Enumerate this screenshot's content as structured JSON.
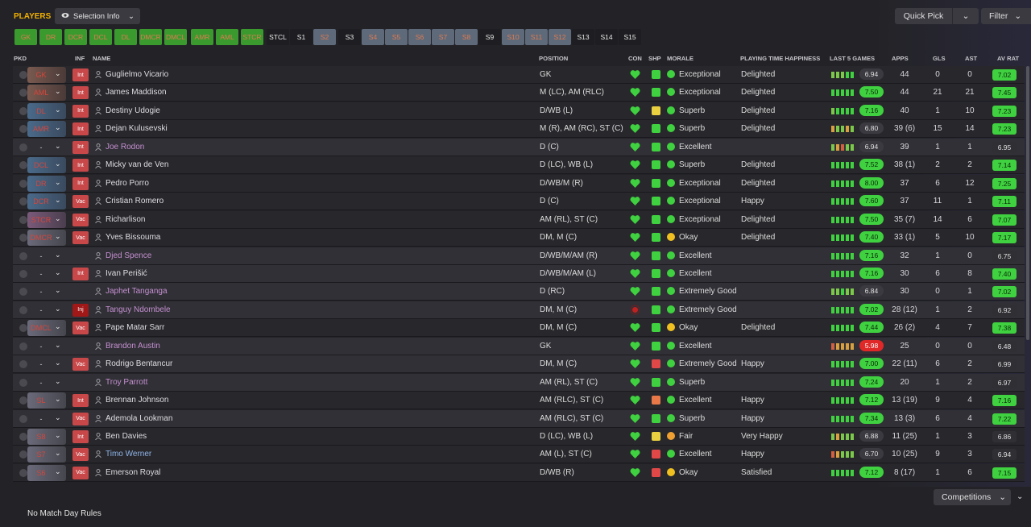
{
  "header": {
    "title": "PLAYERS",
    "selection_info": "Selection Info",
    "quick_pick": "Quick Pick",
    "filter": "Filter"
  },
  "chips": [
    {
      "label": "GK",
      "style": "g"
    },
    {
      "label": "DR",
      "style": "g"
    },
    {
      "label": "DCR",
      "style": "g"
    },
    {
      "label": "DCL",
      "style": "g"
    },
    {
      "label": "DL",
      "style": "g"
    },
    {
      "label": "DMCR",
      "style": "g"
    },
    {
      "label": "DMCL",
      "style": "g"
    },
    {
      "label": "AMR",
      "style": "g"
    },
    {
      "label": "AML",
      "style": "g"
    },
    {
      "label": "STCR",
      "style": "g"
    },
    {
      "label": "STCL",
      "style": "k"
    },
    {
      "label": "S1",
      "style": "k"
    },
    {
      "label": "S2",
      "style": "b"
    },
    {
      "label": "S3",
      "style": "k"
    },
    {
      "label": "S4",
      "style": "b"
    },
    {
      "label": "S5",
      "style": "b"
    },
    {
      "label": "S6",
      "style": "b"
    },
    {
      "label": "S7",
      "style": "b"
    },
    {
      "label": "S8",
      "style": "b"
    },
    {
      "label": "S9",
      "style": "k"
    },
    {
      "label": "S10",
      "style": "b"
    },
    {
      "label": "S11",
      "style": "b"
    },
    {
      "label": "S12",
      "style": "b"
    },
    {
      "label": "S13",
      "style": "k"
    },
    {
      "label": "S14",
      "style": "k"
    },
    {
      "label": "S15",
      "style": "k"
    }
  ],
  "columns": {
    "pkd": "PKD",
    "inf": "INF",
    "name": "NAME",
    "position": "POSITION",
    "con": "CON",
    "shp": "SHP",
    "morale": "MORALE",
    "pth": "PLAYING TIME HAPPINESS",
    "last5": "LAST 5 GAMES",
    "apps": "APPS",
    "gls": "GLS",
    "ast": "AST",
    "avr": "AV RAT"
  },
  "colors": {
    "accent": "#f0b000",
    "good": "#3fd13f",
    "green_chip": "#3a9a2e",
    "inf_red": "#c8484a"
  },
  "rows": [
    {
      "sel": "GK",
      "selStyle": "p",
      "inf": "Int",
      "name": "Guglielmo Vicario",
      "nameStyle": "",
      "pos": "GK",
      "shp": "g",
      "mor": "g",
      "morale": "Exceptional",
      "pth": "Delighted",
      "bars": [
        "#7cc84a",
        "#7cc84a",
        "#7cc84a",
        "#3fd13f",
        "#3fd13f"
      ],
      "l5": "6.94",
      "l5s": "n",
      "apps": "44",
      "gls": "0",
      "ast": "0",
      "avr": "7.02",
      "avrs": "g"
    },
    {
      "sel": "AML",
      "selStyle": "p",
      "inf": "Int",
      "name": "James Maddison",
      "nameStyle": "",
      "pos": "M (LC), AM (RLC)",
      "shp": "g",
      "mor": "g",
      "morale": "Exceptional",
      "pth": "Delighted",
      "bars": [
        "#3fd13f",
        "#3fd13f",
        "#3fd13f",
        "#3fd13f",
        "#3fd13f"
      ],
      "l5": "7.50",
      "l5s": "g",
      "apps": "44",
      "gls": "21",
      "ast": "21",
      "avr": "7.45",
      "avrs": "g"
    },
    {
      "sel": "DL",
      "selStyle": "bl",
      "inf": "Int",
      "name": "Destiny Udogie",
      "nameStyle": "",
      "pos": "D/WB (L)",
      "shp": "y",
      "mor": "g",
      "morale": "Superb",
      "pth": "Delighted",
      "bars": [
        "#7cc84a",
        "#3fd13f",
        "#3fd13f",
        "#3fd13f",
        "#3fd13f"
      ],
      "l5": "7.16",
      "l5s": "g",
      "apps": "40",
      "gls": "1",
      "ast": "10",
      "avr": "7.23",
      "avrs": "g"
    },
    {
      "sel": "AMR",
      "selStyle": "bl",
      "inf": "Int",
      "name": "Dejan Kulusevski",
      "nameStyle": "",
      "pos": "M (R), AM (RC), ST (C)",
      "shp": "g",
      "mor": "g",
      "morale": "Superb",
      "pth": "Delighted",
      "bars": [
        "#d8a040",
        "#7cc84a",
        "#7cc84a",
        "#d8a040",
        "#7cc84a"
      ],
      "l5": "6.80",
      "l5s": "n",
      "apps": "39 (6)",
      "gls": "15",
      "ast": "14",
      "avr": "7.23",
      "avrs": "g"
    },
    {
      "sel": "-",
      "selStyle": "none",
      "inf": "Int",
      "name": "Joe Rodon",
      "nameStyle": "loan",
      "pos": "D (C)",
      "shp": "g",
      "mor": "g",
      "morale": "Excellent",
      "pth": "",
      "bars": [
        "#7cc84a",
        "#d8a040",
        "#d06040",
        "#7cc84a",
        "#7cc84a"
      ],
      "l5": "6.94",
      "l5s": "n",
      "apps": "39",
      "gls": "1",
      "ast": "1",
      "avr": "6.95",
      "avrs": "n"
    },
    {
      "sel": "DCL",
      "selStyle": "bl",
      "inf": "Int",
      "name": "Micky van de Ven",
      "nameStyle": "",
      "pos": "D (LC), WB (L)",
      "shp": "g",
      "mor": "g",
      "morale": "Superb",
      "pth": "Delighted",
      "bars": [
        "#3fd13f",
        "#3fd13f",
        "#3fd13f",
        "#3fd13f",
        "#3fd13f"
      ],
      "l5": "7.52",
      "l5s": "g",
      "apps": "38 (1)",
      "gls": "2",
      "ast": "2",
      "avr": "7.14",
      "avrs": "g"
    },
    {
      "sel": "DR",
      "selStyle": "bl",
      "inf": "Int",
      "name": "Pedro Porro",
      "nameStyle": "",
      "pos": "D/WB/M (R)",
      "shp": "g",
      "mor": "g",
      "morale": "Exceptional",
      "pth": "Delighted",
      "bars": [
        "#3fd13f",
        "#3fd13f",
        "#3fd13f",
        "#3fd13f",
        "#3fd13f"
      ],
      "l5": "8.00",
      "l5s": "g",
      "apps": "37",
      "gls": "6",
      "ast": "12",
      "avr": "7.25",
      "avrs": "g"
    },
    {
      "sel": "DCR",
      "selStyle": "bl",
      "inf": "Vac",
      "name": "Cristian Romero",
      "nameStyle": "",
      "pos": "D (C)",
      "shp": "g",
      "mor": "g",
      "morale": "Exceptional",
      "pth": "Happy",
      "bars": [
        "#3fd13f",
        "#3fd13f",
        "#3fd13f",
        "#3fd13f",
        "#3fd13f"
      ],
      "l5": "7.60",
      "l5s": "g",
      "apps": "37",
      "gls": "11",
      "ast": "1",
      "avr": "7.11",
      "avrs": "g"
    },
    {
      "sel": "STCR",
      "selStyle": "pu",
      "inf": "Vac",
      "name": "Richarlison",
      "nameStyle": "",
      "pos": "AM (RL), ST (C)",
      "shp": "g",
      "mor": "g",
      "morale": "Exceptional",
      "pth": "Delighted",
      "bars": [
        "#3fd13f",
        "#3fd13f",
        "#3fd13f",
        "#3fd13f",
        "#3fd13f"
      ],
      "l5": "7.50",
      "l5s": "g",
      "apps": "35 (7)",
      "gls": "14",
      "ast": "6",
      "avr": "7.07",
      "avrs": "g"
    },
    {
      "sel": "DMCR",
      "selStyle": "gr",
      "inf": "Vac",
      "name": "Yves Bissouma",
      "nameStyle": "",
      "pos": "DM, M (C)",
      "shp": "g",
      "mor": "y",
      "morale": "Okay",
      "pth": "Delighted",
      "bars": [
        "#3fd13f",
        "#3fd13f",
        "#3fd13f",
        "#3fd13f",
        "#3fd13f"
      ],
      "l5": "7.40",
      "l5s": "g",
      "apps": "33 (1)",
      "gls": "5",
      "ast": "10",
      "avr": "7.17",
      "avrs": "g"
    },
    {
      "sel": "-",
      "selStyle": "none",
      "inf": "",
      "name": "Djed Spence",
      "nameStyle": "loan",
      "pos": "D/WB/M/AM (R)",
      "shp": "n",
      "mor": "g",
      "morale": "Excellent",
      "pth": "",
      "bars": [
        "#3fd13f",
        "#3fd13f",
        "#3fd13f",
        "#3fd13f",
        "#3fd13f"
      ],
      "l5": "7.16",
      "l5s": "g",
      "apps": "32",
      "gls": "1",
      "ast": "0",
      "avr": "6.75",
      "avrs": "n"
    },
    {
      "sel": "-",
      "selStyle": "none",
      "inf": "Int",
      "name": "Ivan Perišić",
      "nameStyle": "",
      "pos": "D/WB/M/AM (L)",
      "shp": "g",
      "mor": "g",
      "morale": "Excellent",
      "pth": "",
      "bars": [
        "#3fd13f",
        "#3fd13f",
        "#3fd13f",
        "#3fd13f",
        "#3fd13f"
      ],
      "l5": "7.16",
      "l5s": "g",
      "apps": "30",
      "gls": "6",
      "ast": "8",
      "avr": "7.40",
      "avrs": "g"
    },
    {
      "sel": "-",
      "selStyle": "none",
      "inf": "",
      "name": "Japhet Tanganga",
      "nameStyle": "loan",
      "pos": "D (RC)",
      "shp": "g",
      "mor": "g",
      "morale": "Extremely Good",
      "pth": "",
      "bars": [
        "#7cc84a",
        "#7cc84a",
        "#3fd13f",
        "#7cc84a",
        "#7cc84a"
      ],
      "l5": "6.84",
      "l5s": "n",
      "apps": "30",
      "gls": "0",
      "ast": "1",
      "avr": "7.02",
      "avrs": "g"
    },
    {
      "sel": "-",
      "selStyle": "none",
      "inf": "Inj",
      "name": "Tanguy Ndombele",
      "nameStyle": "loan",
      "pos": "DM, M (C)",
      "shp": "n",
      "mor": "g",
      "morale": "Extremely Good",
      "pth": "",
      "bars": [
        "#3fd13f",
        "#3fd13f",
        "#3fd13f",
        "#3fd13f",
        "#3fd13f"
      ],
      "l5": "7.02",
      "l5s": "g",
      "apps": "28 (12)",
      "gls": "1",
      "ast": "2",
      "avr": "6.92",
      "avrs": "n",
      "injured": true
    },
    {
      "sel": "DMCL",
      "selStyle": "gr",
      "inf": "Vac",
      "name": "Pape Matar Sarr",
      "nameStyle": "",
      "pos": "DM, M (C)",
      "shp": "g",
      "mor": "y",
      "morale": "Okay",
      "pth": "Delighted",
      "bars": [
        "#3fd13f",
        "#3fd13f",
        "#3fd13f",
        "#3fd13f",
        "#3fd13f"
      ],
      "l5": "7.44",
      "l5s": "g",
      "apps": "26 (2)",
      "gls": "4",
      "ast": "7",
      "avr": "7.38",
      "avrs": "g"
    },
    {
      "sel": "-",
      "selStyle": "none",
      "inf": "",
      "name": "Brandon Austin",
      "nameStyle": "loan",
      "pos": "GK",
      "shp": "g",
      "mor": "g",
      "morale": "Excellent",
      "pth": "",
      "bars": [
        "#d06040",
        "#d8a040",
        "#d8a040",
        "#d8a040",
        "#d8a040"
      ],
      "l5": "5.98",
      "l5s": "r",
      "apps": "25",
      "gls": "0",
      "ast": "0",
      "avr": "6.48",
      "avrs": "n"
    },
    {
      "sel": "-",
      "selStyle": "none",
      "inf": "Vac",
      "name": "Rodrigo Bentancur",
      "nameStyle": "",
      "pos": "DM, M (C)",
      "shp": "r",
      "mor": "g",
      "morale": "Extremely Good",
      "pth": "Happy",
      "bars": [
        "#3fd13f",
        "#3fd13f",
        "#3fd13f",
        "#3fd13f",
        "#3fd13f"
      ],
      "l5": "7.00",
      "l5s": "g",
      "apps": "22 (11)",
      "gls": "6",
      "ast": "2",
      "avr": "6.99",
      "avrs": "n"
    },
    {
      "sel": "-",
      "selStyle": "none",
      "inf": "",
      "name": "Troy Parrott",
      "nameStyle": "loan",
      "pos": "AM (RL), ST (C)",
      "shp": "g",
      "mor": "g",
      "morale": "Superb",
      "pth": "",
      "bars": [
        "#3fd13f",
        "#3fd13f",
        "#3fd13f",
        "#3fd13f",
        "#3fd13f"
      ],
      "l5": "7.24",
      "l5s": "g",
      "apps": "20",
      "gls": "1",
      "ast": "2",
      "avr": "6.97",
      "avrs": "n"
    },
    {
      "sel": "SL",
      "selStyle": "gr",
      "inf": "Int",
      "name": "Brennan Johnson",
      "nameStyle": "",
      "pos": "AM (RLC), ST (C)",
      "shp": "o",
      "mor": "g",
      "morale": "Excellent",
      "pth": "Happy",
      "bars": [
        "#3fd13f",
        "#3fd13f",
        "#3fd13f",
        "#3fd13f",
        "#3fd13f"
      ],
      "l5": "7.12",
      "l5s": "g",
      "apps": "13 (19)",
      "gls": "9",
      "ast": "4",
      "avr": "7.16",
      "avrs": "g"
    },
    {
      "sel": "-",
      "selStyle": "none",
      "inf": "Vac",
      "name": "Ademola Lookman",
      "nameStyle": "",
      "pos": "AM (RLC), ST (C)",
      "shp": "g",
      "mor": "g",
      "morale": "Superb",
      "pth": "Happy",
      "bars": [
        "#3fd13f",
        "#3fd13f",
        "#3fd13f",
        "#3fd13f",
        "#3fd13f"
      ],
      "l5": "7.34",
      "l5s": "g",
      "apps": "13 (3)",
      "gls": "6",
      "ast": "4",
      "avr": "7.22",
      "avrs": "g"
    },
    {
      "sel": "S8",
      "selStyle": "gr",
      "inf": "Int",
      "name": "Ben Davies",
      "nameStyle": "",
      "pos": "D (LC), WB (L)",
      "shp": "y",
      "mor": "o",
      "morale": "Fair",
      "pth": "Very Happy",
      "bars": [
        "#7cc84a",
        "#d8a040",
        "#7cc84a",
        "#7cc84a",
        "#7cc84a"
      ],
      "l5": "6.88",
      "l5s": "n",
      "apps": "11 (25)",
      "gls": "1",
      "ast": "3",
      "avr": "6.86",
      "avrs": "n"
    },
    {
      "sel": "S7",
      "selStyle": "gr",
      "inf": "Vac",
      "name": "Timo Werner",
      "nameStyle": "blue",
      "pos": "AM (L), ST (C)",
      "shp": "r",
      "mor": "g",
      "morale": "Excellent",
      "pth": "Happy",
      "bars": [
        "#d06040",
        "#d8a040",
        "#7cc84a",
        "#7cc84a",
        "#7cc84a"
      ],
      "l5": "6.70",
      "l5s": "n",
      "apps": "10 (25)",
      "gls": "9",
      "ast": "3",
      "avr": "6.94",
      "avrs": "n"
    },
    {
      "sel": "S6",
      "selStyle": "gr",
      "inf": "Vac",
      "name": "Emerson Royal",
      "nameStyle": "",
      "pos": "D/WB (R)",
      "shp": "r",
      "mor": "y",
      "morale": "Okay",
      "pth": "Satisfied",
      "bars": [
        "#3fd13f",
        "#3fd13f",
        "#3fd13f",
        "#3fd13f",
        "#3fd13f"
      ],
      "l5": "7.12",
      "l5s": "g",
      "apps": "8 (17)",
      "gls": "1",
      "ast": "6",
      "avr": "7.15",
      "avrs": "g"
    }
  ],
  "footer": {
    "no_match_day": "No Match Day Rules",
    "competitions": "Competitions"
  }
}
